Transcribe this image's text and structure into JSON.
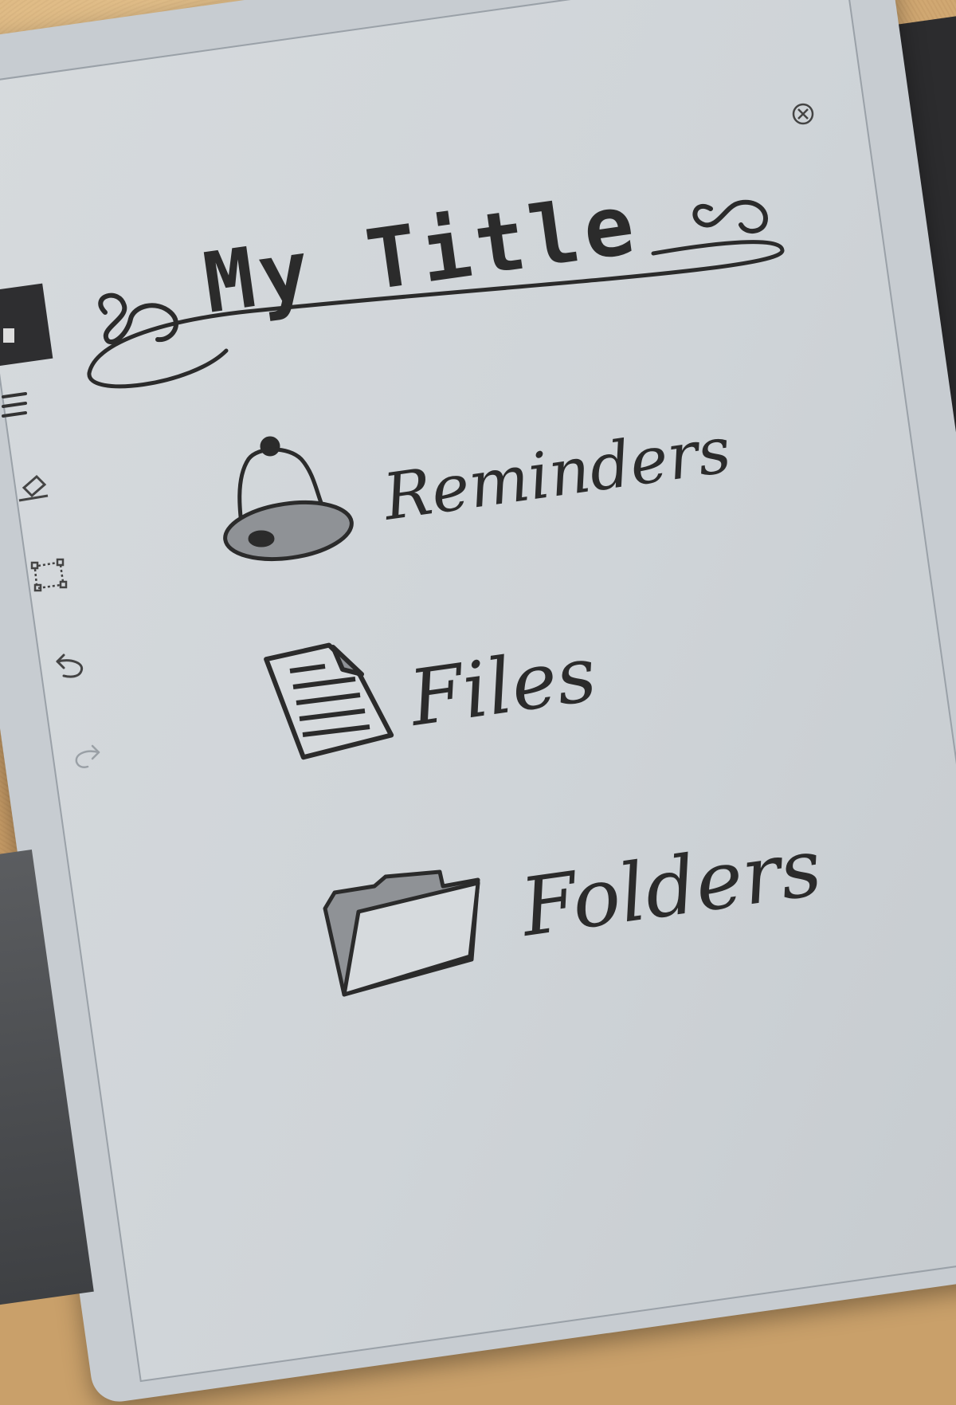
{
  "page": {
    "title": "My Title",
    "items": [
      {
        "label": "Reminders",
        "icon": "bell-icon"
      },
      {
        "label": "Files",
        "icon": "document-icon"
      },
      {
        "label": "Folders",
        "icon": "folder-icon"
      }
    ]
  },
  "toolbar": {
    "icons": [
      "menu-icon",
      "eraser-icon",
      "selection-icon",
      "undo-icon",
      "redo-icon"
    ]
  },
  "colors": {
    "ink": "#2b2b2b",
    "screen": "#d2d6da",
    "desk": "#c9a06a",
    "cover": "#2c2c2e"
  }
}
